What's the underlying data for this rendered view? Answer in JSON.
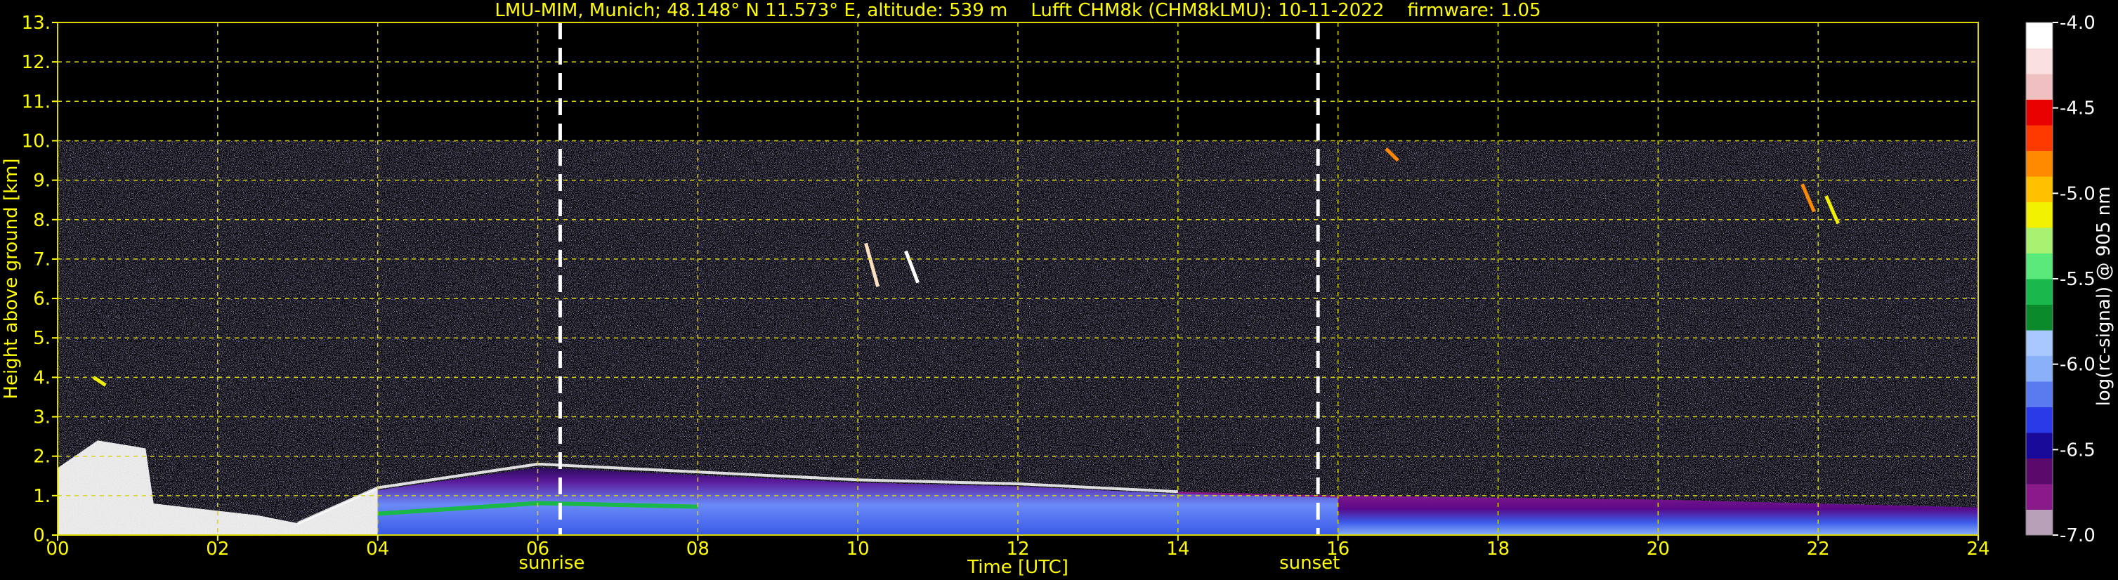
{
  "chart_data": {
    "type": "heatmap",
    "title": "LMU-MIM, Munich; 48.148° N 11.573° E, altitude: 539 m    Lufft CHM8k (CHM8kLMU): 10-11-2022    firmware: 1.05",
    "xlabel": "Time [UTC]",
    "ylabel": "Height above ground [km]",
    "xlim": [
      0,
      24
    ],
    "ylim": [
      0,
      13
    ],
    "x_ticks": [
      "00",
      "02",
      "04",
      "06",
      "08",
      "10",
      "12",
      "14",
      "16",
      "18",
      "20",
      "22",
      "24"
    ],
    "y_ticks": [
      "0.",
      "1.",
      "2.",
      "3.",
      "4.",
      "5.",
      "6.",
      "7.",
      "8.",
      "9.",
      "10.",
      "11.",
      "12.",
      "13."
    ],
    "grid": true,
    "colorbar": {
      "label": "log(rc-signal) @ 905 nm",
      "range": [
        -7.0,
        -4.0
      ],
      "ticks": [
        "-4.0",
        "-4.5",
        "-5.0",
        "-5.5",
        "-6.0",
        "-6.5",
        "-7.0"
      ],
      "colors": [
        "#b8a0b8",
        "#8a1a8a",
        "#5a0a6a",
        "#1a0a9a",
        "#2a3ae8",
        "#5a7af0",
        "#8ab0f8",
        "#a8c8ff",
        "#0a8a2a",
        "#1ab84a",
        "#5ae87a",
        "#a8f070",
        "#f0f000",
        "#ffc000",
        "#ff8a00",
        "#ff3a00",
        "#e80000",
        "#f0c0c0",
        "#f8e0e0",
        "#ffffff"
      ]
    },
    "events": [
      {
        "label": "sunrise",
        "time": 6.28
      },
      {
        "label": "sunset",
        "time": 15.75
      }
    ],
    "data_top_km": 10.0,
    "boundary_layer": [
      {
        "t": 0,
        "top": 1.7
      },
      {
        "t": 0.5,
        "top": 2.4
      },
      {
        "t": 1.1,
        "top": 2.2
      },
      {
        "t": 1.2,
        "top": 0.8
      },
      {
        "t": 2.5,
        "top": 0.5
      },
      {
        "t": 3.0,
        "top": 0.3
      },
      {
        "t": 4.0,
        "top": 1.2
      },
      {
        "t": 5.0,
        "top": 1.5
      },
      {
        "t": 6.0,
        "top": 1.8
      },
      {
        "t": 7.0,
        "top": 1.7
      },
      {
        "t": 8.0,
        "top": 1.6
      },
      {
        "t": 10.0,
        "top": 1.4
      },
      {
        "t": 12.0,
        "top": 1.3
      },
      {
        "t": 14.0,
        "top": 1.1
      },
      {
        "t": 16.0,
        "top": 1.0
      },
      {
        "t": 18.0,
        "top": 0.95
      },
      {
        "t": 20.0,
        "top": 0.9
      },
      {
        "t": 22.0,
        "top": 0.8
      },
      {
        "t": 24.0,
        "top": 0.7
      }
    ]
  },
  "colors": {
    "text": "#ffff00",
    "grid": "#d8d800",
    "marker": "#ffffff"
  }
}
